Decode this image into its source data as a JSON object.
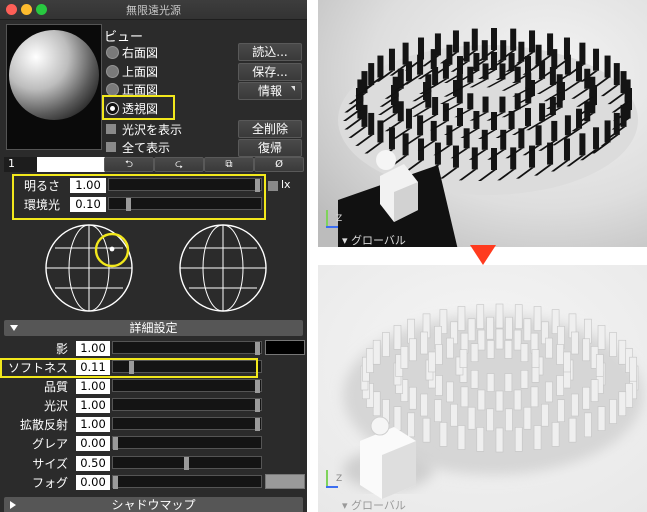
{
  "window": {
    "title": "無限遠光源",
    "view_heading": "ビュー",
    "views": [
      {
        "label": "右面図",
        "selected": false
      },
      {
        "label": "上面図",
        "selected": false
      },
      {
        "label": "正面図",
        "selected": false
      },
      {
        "label": "透視図",
        "selected": true
      }
    ],
    "checks": [
      {
        "label": "光沢を表示"
      },
      {
        "label": "全て表示"
      }
    ],
    "buttons": {
      "load": "読込...",
      "save": "保存...",
      "info": "情報",
      "delete_all": "全削除",
      "restore": "復帰"
    },
    "light_index": "1",
    "toolbar_glyphs": [
      "⮌",
      "⮎",
      "⧉",
      "Ø"
    ],
    "brightness": {
      "label": "明るさ",
      "value": "1.00",
      "level": 1.0
    },
    "ambient": {
      "label": "環境光",
      "value": "0.10",
      "level": 0.1
    },
    "lx_label": "lx",
    "details_section": "詳細設定",
    "shadow_section": "シャドウマップ",
    "detail_rows": [
      {
        "label": "影",
        "value": "1.00",
        "level": 1.0
      },
      {
        "label": "ソフトネス",
        "value": "0.11",
        "level": 0.11
      },
      {
        "label": "品質",
        "value": "1.00",
        "level": 1.0
      },
      {
        "label": "光沢",
        "value": "1.00",
        "level": 1.0
      },
      {
        "label": "拡散反射",
        "value": "1.00",
        "level": 1.0
      },
      {
        "label": "グレア",
        "value": "0.00",
        "level": 0.0
      },
      {
        "label": "サイズ",
        "value": "0.50",
        "level": 0.5
      },
      {
        "label": "フォグ",
        "value": "0.00",
        "level": 0.0
      }
    ]
  },
  "scenes": {
    "top_label": "グローバル",
    "bottom_label": "グローバル",
    "axis_z": "Z"
  },
  "colors": {
    "highlight": "#f2e81c",
    "arrow": "#ff3b1f"
  }
}
